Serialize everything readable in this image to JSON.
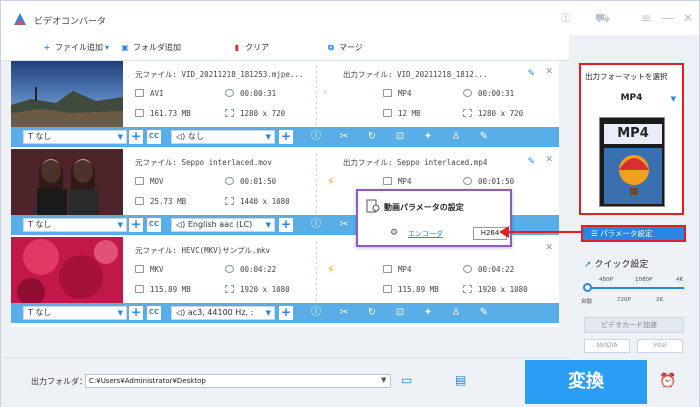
{
  "app": {
    "title": "ビデオコンバータ"
  },
  "toolbar": {
    "add_file": "ファイル追加",
    "add_folder": "フォルダ追加",
    "clear": "クリア",
    "merge": "マージ"
  },
  "rows": [
    {
      "src_name": "元ファイル: VID_20211218_181253.mjpe...",
      "src_format": "AVI",
      "src_duration": "00:00:31",
      "src_size": "161.73 MB",
      "src_res": "1280 x 720",
      "dst_name": "出力ファイル: VID_20211218_1812...",
      "dst_format": "MP4",
      "dst_duration": "00:00:31",
      "dst_size": "12 MB",
      "dst_res": "1280 x 720",
      "subtitle": "なし",
      "audio": "なし"
    },
    {
      "src_name": "元ファイル: Seppo interlaced.mov",
      "src_format": "MOV",
      "src_duration": "00:01:50",
      "src_size": "25.73 MB",
      "src_res": "1440 x 1080",
      "dst_name": "出力ファイル: Seppo interlaced.mp4",
      "dst_format": "MP4",
      "dst_duration": "00:01:50",
      "dst_size": "",
      "dst_res": "",
      "subtitle": "なし",
      "audio": "English aac (LC)"
    },
    {
      "src_name": "元ファイル: HEVC(MKV)サンプル.mkv",
      "src_format": "MKV",
      "src_duration": "00:04:22",
      "src_size": "115.89 MB",
      "src_res": "1920 x 1080",
      "dst_name": "",
      "dst_format": "MP4",
      "dst_duration": "00:04:22",
      "dst_size": "115.89 MB",
      "dst_res": "1920 x 1080",
      "subtitle": "なし",
      "audio": "ac3, 44100 Hz, :"
    }
  ],
  "popup": {
    "title": "動画パラメータの設定",
    "encoder_label": "エンコーダ",
    "encoder_value": "H264"
  },
  "sidebar": {
    "format_label": "出力フォーマットを選択",
    "format_value": "MP4",
    "format_icon_text": "MP4",
    "param_button": "パラメータ設定",
    "quick_label": "クイック設定",
    "slider_top": [
      "480P",
      "1080P",
      "4K"
    ],
    "slider_bottom": [
      "自動",
      "720P",
      "2K"
    ],
    "gpu_label": "ビデオカード加速",
    "badge_nvidia": "NVIDIA",
    "badge_intel": "Intel"
  },
  "bottom": {
    "output_label": "出力フォルダ：",
    "output_path": "C:¥Users¥Administrator¥Desktop",
    "convert": "変換"
  },
  "colors": {
    "accent": "#2a86e0",
    "bar": "#5aaee8",
    "highlight": "#e02020",
    "popup_border": "#8a5ad0",
    "convert": "#2a9df4"
  }
}
